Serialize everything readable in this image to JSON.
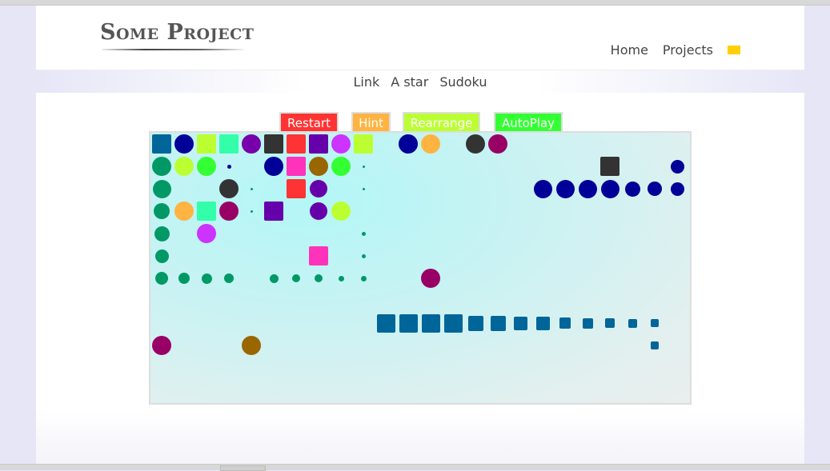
{
  "header": {
    "logo": "Some Project",
    "nav": [
      {
        "label": "Home"
      },
      {
        "label": "Projects"
      }
    ],
    "flag_color": "#ffd000",
    "flag_icon": "language-flag-icon"
  },
  "subnav": [
    {
      "label": "Link"
    },
    {
      "label": "A star"
    },
    {
      "label": "Sudoku"
    }
  ],
  "controls": {
    "restart": {
      "label": "Restart",
      "color": "#ff3333"
    },
    "hint": {
      "label": "Hint",
      "color": "#ffb340"
    },
    "rearrange": {
      "label": "Rearrange",
      "color": "#bbff33"
    },
    "autoplay": {
      "label": "AutoPlay",
      "color": "#33ff33"
    }
  },
  "palette": {
    "teal_blue": "#006699",
    "navy": "#000099",
    "lime": "#bbff33",
    "aqua_green": "#33ffaa",
    "purple": "#7700aa",
    "charcoal": "#333333",
    "red": "#ff3333",
    "violet": "#6600aa",
    "magenta_light": "#cc33ff",
    "green_sea": "#009966",
    "bright_green": "#33ff33",
    "pink": "#ff33bb",
    "brown": "#996600",
    "orange": "#ffb340",
    "maroon": "#990066"
  },
  "board": {
    "columns": 24,
    "rows": 12,
    "pieces": [
      {
        "col": 0,
        "row": 0,
        "shape": "square",
        "color": "teal_blue",
        "size": 1
      },
      {
        "col": 1,
        "row": 0,
        "shape": "circle",
        "color": "navy",
        "size": 1
      },
      {
        "col": 2,
        "row": 0,
        "shape": "square",
        "color": "lime",
        "size": 1
      },
      {
        "col": 3,
        "row": 0,
        "shape": "square",
        "color": "aqua_green",
        "size": 1
      },
      {
        "col": 4,
        "row": 0,
        "shape": "circle",
        "color": "purple",
        "size": 1
      },
      {
        "col": 5,
        "row": 0,
        "shape": "square",
        "color": "charcoal",
        "size": 1
      },
      {
        "col": 6,
        "row": 0,
        "shape": "square",
        "color": "red",
        "size": 1
      },
      {
        "col": 7,
        "row": 0,
        "shape": "square",
        "color": "violet",
        "size": 1
      },
      {
        "col": 8,
        "row": 0,
        "shape": "circle",
        "color": "magenta_light",
        "size": 1
      },
      {
        "col": 9,
        "row": 0,
        "shape": "square",
        "color": "lime",
        "size": 1
      },
      {
        "col": 11,
        "row": 0,
        "shape": "circle",
        "color": "navy",
        "size": 1
      },
      {
        "col": 12,
        "row": 0,
        "shape": "circle",
        "color": "orange",
        "size": 1
      },
      {
        "col": 14,
        "row": 0,
        "shape": "circle",
        "color": "charcoal",
        "size": 1
      },
      {
        "col": 15,
        "row": 0,
        "shape": "circle",
        "color": "maroon",
        "size": 1
      },
      {
        "col": 0,
        "row": 1,
        "shape": "circle",
        "color": "green_sea",
        "size": 1
      },
      {
        "col": 1,
        "row": 1,
        "shape": "circle",
        "color": "lime",
        "size": 1
      },
      {
        "col": 2,
        "row": 1,
        "shape": "circle",
        "color": "bright_green",
        "size": 1
      },
      {
        "col": 3,
        "row": 1,
        "shape": "circle",
        "color": "navy",
        "size": 0.2
      },
      {
        "col": 5,
        "row": 1,
        "shape": "circle",
        "color": "navy",
        "size": 1
      },
      {
        "col": 6,
        "row": 1,
        "shape": "square",
        "color": "pink",
        "size": 1
      },
      {
        "col": 7,
        "row": 1,
        "shape": "circle",
        "color": "brown",
        "size": 1
      },
      {
        "col": 8,
        "row": 1,
        "shape": "circle",
        "color": "bright_green",
        "size": 1
      },
      {
        "col": 9,
        "row": 1,
        "shape": "circle",
        "color": "green_sea",
        "size": 0.1
      },
      {
        "col": 20,
        "row": 1,
        "shape": "square",
        "color": "charcoal",
        "size": 1
      },
      {
        "col": 23,
        "row": 1,
        "shape": "circle",
        "color": "navy",
        "size": 0.7
      },
      {
        "col": 0,
        "row": 2,
        "shape": "circle",
        "color": "green_sea",
        "size": 0.95
      },
      {
        "col": 3,
        "row": 2,
        "shape": "circle",
        "color": "charcoal",
        "size": 1
      },
      {
        "col": 4,
        "row": 2,
        "shape": "circle",
        "color": "green_sea",
        "size": 0.1
      },
      {
        "col": 6,
        "row": 2,
        "shape": "square",
        "color": "red",
        "size": 1
      },
      {
        "col": 7,
        "row": 2,
        "shape": "circle",
        "color": "violet",
        "size": 0.9
      },
      {
        "col": 9,
        "row": 2,
        "shape": "circle",
        "color": "green_sea",
        "size": 0.1
      },
      {
        "col": 17,
        "row": 2,
        "shape": "circle",
        "color": "navy",
        "size": 0.95
      },
      {
        "col": 18,
        "row": 2,
        "shape": "circle",
        "color": "navy",
        "size": 0.95
      },
      {
        "col": 19,
        "row": 2,
        "shape": "circle",
        "color": "navy",
        "size": 0.95
      },
      {
        "col": 20,
        "row": 2,
        "shape": "circle",
        "color": "navy",
        "size": 0.95
      },
      {
        "col": 21,
        "row": 2,
        "shape": "circle",
        "color": "navy",
        "size": 0.8
      },
      {
        "col": 22,
        "row": 2,
        "shape": "circle",
        "color": "navy",
        "size": 0.75
      },
      {
        "col": 23,
        "row": 2,
        "shape": "circle",
        "color": "navy",
        "size": 0.7
      },
      {
        "col": 0,
        "row": 3,
        "shape": "circle",
        "color": "green_sea",
        "size": 0.85
      },
      {
        "col": 1,
        "row": 3,
        "shape": "circle",
        "color": "orange",
        "size": 1
      },
      {
        "col": 2,
        "row": 3,
        "shape": "square",
        "color": "aqua_green",
        "size": 1
      },
      {
        "col": 3,
        "row": 3,
        "shape": "circle",
        "color": "maroon",
        "size": 1
      },
      {
        "col": 4,
        "row": 3,
        "shape": "circle",
        "color": "green_sea",
        "size": 0.1
      },
      {
        "col": 5,
        "row": 3,
        "shape": "square",
        "color": "violet",
        "size": 1
      },
      {
        "col": 7,
        "row": 3,
        "shape": "circle",
        "color": "violet",
        "size": 0.9
      },
      {
        "col": 8,
        "row": 3,
        "shape": "circle",
        "color": "lime",
        "size": 1
      },
      {
        "col": 0,
        "row": 4,
        "shape": "circle",
        "color": "green_sea",
        "size": 0.8
      },
      {
        "col": 2,
        "row": 4,
        "shape": "circle",
        "color": "magenta_light",
        "size": 1
      },
      {
        "col": 9,
        "row": 4,
        "shape": "circle",
        "color": "green_sea",
        "size": 0.2
      },
      {
        "col": 0,
        "row": 5,
        "shape": "circle",
        "color": "green_sea",
        "size": 0.7
      },
      {
        "col": 7,
        "row": 5,
        "shape": "square",
        "color": "pink",
        "size": 1
      },
      {
        "col": 9,
        "row": 5,
        "shape": "circle",
        "color": "green_sea",
        "size": 0.2
      },
      {
        "col": 0,
        "row": 6,
        "shape": "circle",
        "color": "green_sea",
        "size": 0.65
      },
      {
        "col": 1,
        "row": 6,
        "shape": "circle",
        "color": "green_sea",
        "size": 0.6
      },
      {
        "col": 2,
        "row": 6,
        "shape": "circle",
        "color": "green_sea",
        "size": 0.55
      },
      {
        "col": 3,
        "row": 6,
        "shape": "circle",
        "color": "green_sea",
        "size": 0.5
      },
      {
        "col": 5,
        "row": 6,
        "shape": "circle",
        "color": "green_sea",
        "size": 0.45
      },
      {
        "col": 6,
        "row": 6,
        "shape": "circle",
        "color": "green_sea",
        "size": 0.4
      },
      {
        "col": 7,
        "row": 6,
        "shape": "circle",
        "color": "green_sea",
        "size": 0.4
      },
      {
        "col": 8,
        "row": 6,
        "shape": "circle",
        "color": "green_sea",
        "size": 0.3
      },
      {
        "col": 9,
        "row": 6,
        "shape": "circle",
        "color": "green_sea",
        "size": 0.3
      },
      {
        "col": 12,
        "row": 6,
        "shape": "circle",
        "color": "maroon",
        "size": 1
      },
      {
        "col": 10,
        "row": 8,
        "shape": "square",
        "color": "teal_blue",
        "size": 0.95
      },
      {
        "col": 11,
        "row": 8,
        "shape": "square",
        "color": "teal_blue",
        "size": 0.95
      },
      {
        "col": 12,
        "row": 8,
        "shape": "square",
        "color": "teal_blue",
        "size": 0.95
      },
      {
        "col": 13,
        "row": 8,
        "shape": "square",
        "color": "teal_blue",
        "size": 0.95
      },
      {
        "col": 14,
        "row": 8,
        "shape": "square",
        "color": "teal_blue",
        "size": 0.8
      },
      {
        "col": 15,
        "row": 8,
        "shape": "square",
        "color": "teal_blue",
        "size": 0.8
      },
      {
        "col": 16,
        "row": 8,
        "shape": "square",
        "color": "teal_blue",
        "size": 0.7
      },
      {
        "col": 17,
        "row": 8,
        "shape": "square",
        "color": "teal_blue",
        "size": 0.7
      },
      {
        "col": 18,
        "row": 8,
        "shape": "square",
        "color": "teal_blue",
        "size": 0.6
      },
      {
        "col": 19,
        "row": 8,
        "shape": "square",
        "color": "teal_blue",
        "size": 0.55
      },
      {
        "col": 20,
        "row": 8,
        "shape": "square",
        "color": "teal_blue",
        "size": 0.5
      },
      {
        "col": 21,
        "row": 8,
        "shape": "square",
        "color": "teal_blue",
        "size": 0.45
      },
      {
        "col": 22,
        "row": 8,
        "shape": "square",
        "color": "teal_blue",
        "size": 0.4
      },
      {
        "col": 0,
        "row": 9,
        "shape": "circle",
        "color": "maroon",
        "size": 1
      },
      {
        "col": 4,
        "row": 9,
        "shape": "circle",
        "color": "brown",
        "size": 1
      },
      {
        "col": 22,
        "row": 9,
        "shape": "square",
        "color": "teal_blue",
        "size": 0.4
      }
    ]
  }
}
